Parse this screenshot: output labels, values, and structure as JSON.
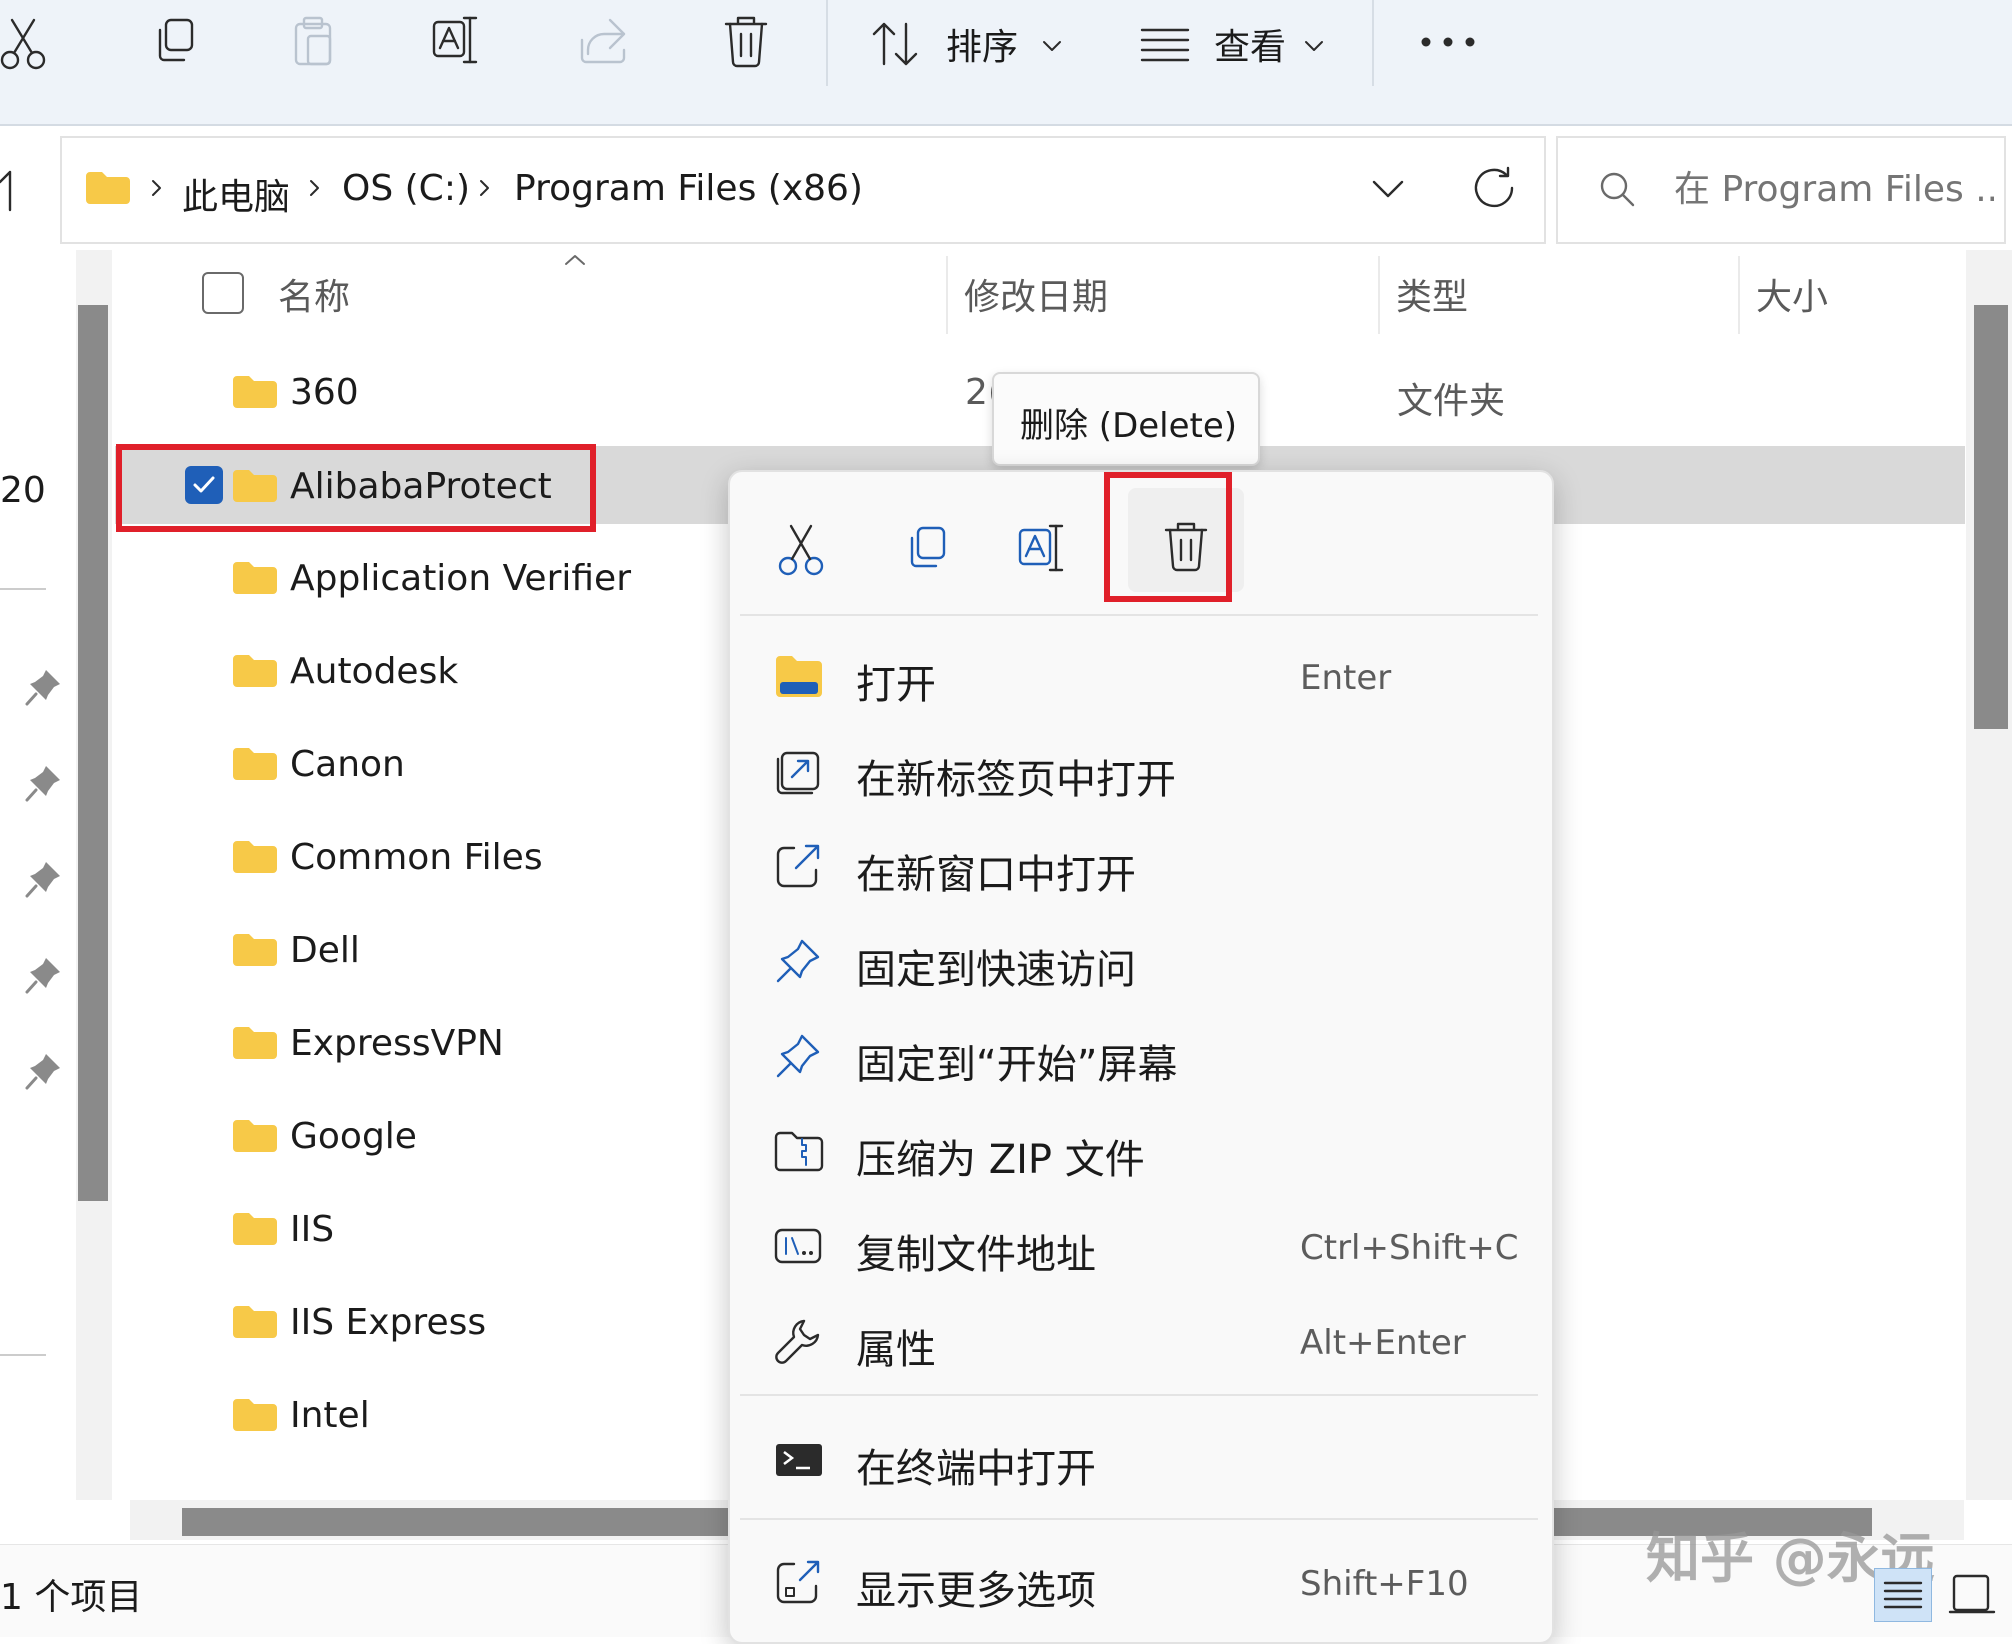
{
  "toolbar": {
    "sort_label": "排序",
    "view_label": "查看"
  },
  "address": {
    "crumbs": [
      "此电脑",
      "OS (C:)",
      "Program Files (x86)"
    ]
  },
  "search": {
    "placeholder": "在 Program Files ..."
  },
  "nav": {
    "partial_text": "20"
  },
  "columns": [
    "名称",
    "修改日期",
    "类型",
    "大小"
  ],
  "rows": [
    {
      "name": "360",
      "date": "2(",
      "type": "文件夹"
    },
    {
      "name": "AlibabaProtect"
    },
    {
      "name": "Application Verifier"
    },
    {
      "name": "Autodesk"
    },
    {
      "name": "Canon"
    },
    {
      "name": "Common Files"
    },
    {
      "name": "Dell"
    },
    {
      "name": "ExpressVPN"
    },
    {
      "name": "Google"
    },
    {
      "name": "IIS"
    },
    {
      "name": "IIS Express"
    },
    {
      "name": "Intel"
    }
  ],
  "tooltip": "删除 (Delete)",
  "menu": {
    "items": [
      {
        "label": "打开",
        "shortcut": "Enter"
      },
      {
        "label": "在新标签页中打开",
        "shortcut": ""
      },
      {
        "label": "在新窗口中打开",
        "shortcut": ""
      },
      {
        "label": "固定到快速访问",
        "shortcut": ""
      },
      {
        "label": "固定到“开始”屏幕",
        "shortcut": ""
      },
      {
        "label": "压缩为 ZIP 文件",
        "shortcut": ""
      },
      {
        "label": "复制文件地址",
        "shortcut": "Ctrl+Shift+C"
      },
      {
        "label": "属性",
        "shortcut": "Alt+Enter"
      },
      {
        "label": "在终端中打开",
        "shortcut": ""
      },
      {
        "label": "显示更多选项",
        "shortcut": "Shift+F10"
      }
    ]
  },
  "status": "1 个项目",
  "watermark": "知乎 @永远",
  "colors": {
    "highlight": "#e0202a",
    "accent": "#1f5fb8",
    "folder": "#f7c948"
  }
}
